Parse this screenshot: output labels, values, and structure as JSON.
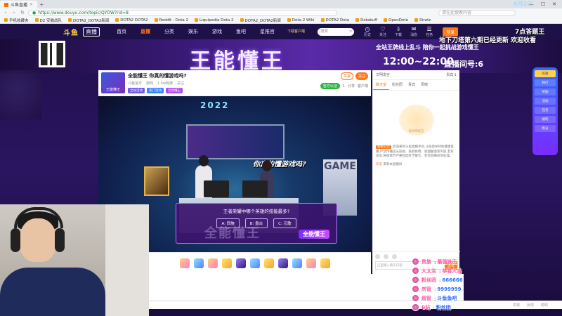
{
  "browser": {
    "tab_title": "斗鱼直播",
    "tab_close": "×",
    "new_tab": "+",
    "url": "https://www.douyu.com/topic/QYDW?rid=8",
    "side_search_placeholder": "请在此搜索内容",
    "bookmarks": [
      "手机收藏夹",
      "D2 安徽战队",
      "DOTA2_DOTA2新闻",
      "DOTA2 DOTA2",
      "Reddit - Dota 2",
      "Liquipedia Dota 2",
      "DOTA2_DOTA2新闻",
      "Dota 2 Wiki",
      "DOTA2 Dota",
      "Dotabuff",
      "OpenDota",
      "Stratz"
    ],
    "nav_back": "‹",
    "nav_forward": "›",
    "nav_reload": "↻",
    "win_min": "—",
    "win_max": "☐",
    "win_close": "✕"
  },
  "site": {
    "logo": "斗鱼",
    "logo_badge": "直播",
    "nav": [
      "首页",
      "直播",
      "分类",
      "娱乐",
      "游戏",
      "鱼吧",
      "星推官"
    ],
    "download_text": "下载客户端",
    "search_placeholder": "搜索",
    "icons": [
      "历史",
      "关注",
      "下载",
      "消息",
      "任务"
    ],
    "login": "登录"
  },
  "banner": {
    "title": "王能懂王",
    "subtitle": "全站王牌线上乱斗 陪你一起挑战游戏懂王",
    "time": "12:00~22:00",
    "room": "直播间号:6",
    "overlay": "地下刀塔第六期已经更新 欢迎收看",
    "overlay_badge": "7点答题王",
    "clock": "6月2日"
  },
  "room": {
    "avatar_label": "王能懂王",
    "title": "全能懂王 你真的懂游戏吗?",
    "meta": [
      "斗鱼官方",
      "游戏",
      "1.5w热度",
      "关注"
    ],
    "tags": [
      "全站活动",
      "热门活动",
      "全能懂王"
    ],
    "btn_report": "举报",
    "btn_follow": "关注",
    "followers_chip": "官方认证",
    "follower_count": "1",
    "share": "分享",
    "client": "客户端"
  },
  "stage": {
    "year": "2022",
    "slogan": "你真的懂游戏吗?",
    "right_text": "GAME",
    "question": "王者荣耀中哪个英雄的技能最多?",
    "options": [
      "A: 西施",
      "B: 盘古",
      "C: 元歌"
    ],
    "brand": "全能懂王",
    "ghost": "全能懂王"
  },
  "chat": {
    "top_left": "文明发言",
    "top_right": "贵宾 1",
    "tabs": [
      "聊天室",
      "粉丝团",
      "贵宾",
      "周榜"
    ],
    "mascot": "请文明发言",
    "notice_label": "系统公告",
    "notice": "欢迎来到斗鱼直播平台,斗鱼倡导绿色健康直播,严禁传播违法违规、低俗色情、吸烟酗酒等内容,若有违反,将视情节严重程度给予警告、封停直播间等处理。",
    "welcome_user": "欢迎",
    "welcome": "来到本直播间",
    "input_placeholder": "这里输入聊天内容",
    "send": "发送"
  },
  "rail": [
    "答题",
    "排行",
    "奖励",
    "活动",
    "任务",
    "福利",
    "积分"
  ],
  "donors": [
    {
      "label": "贵族",
      "sep": ":",
      "value": "最强铁王"
    },
    {
      "label": "大太宝",
      "sep": ":",
      "value": "恭喜大吉"
    },
    {
      "label": "粉丝团",
      "sep": ":",
      "value": "666666"
    },
    {
      "label": "房管",
      "sep": ":",
      "value": "9999999"
    },
    {
      "label": "超管",
      "sep": ":",
      "value": "斗鱼鱼吧"
    },
    {
      "label": "B站",
      "sep": ":",
      "value": "粉丝团"
    }
  ],
  "footer": [
    "举报",
    "反馈",
    "帮助"
  ],
  "colors": {
    "accent": "#ff7a1a",
    "nav_bg": "#1d1147",
    "donor": "#ff5a9c"
  }
}
